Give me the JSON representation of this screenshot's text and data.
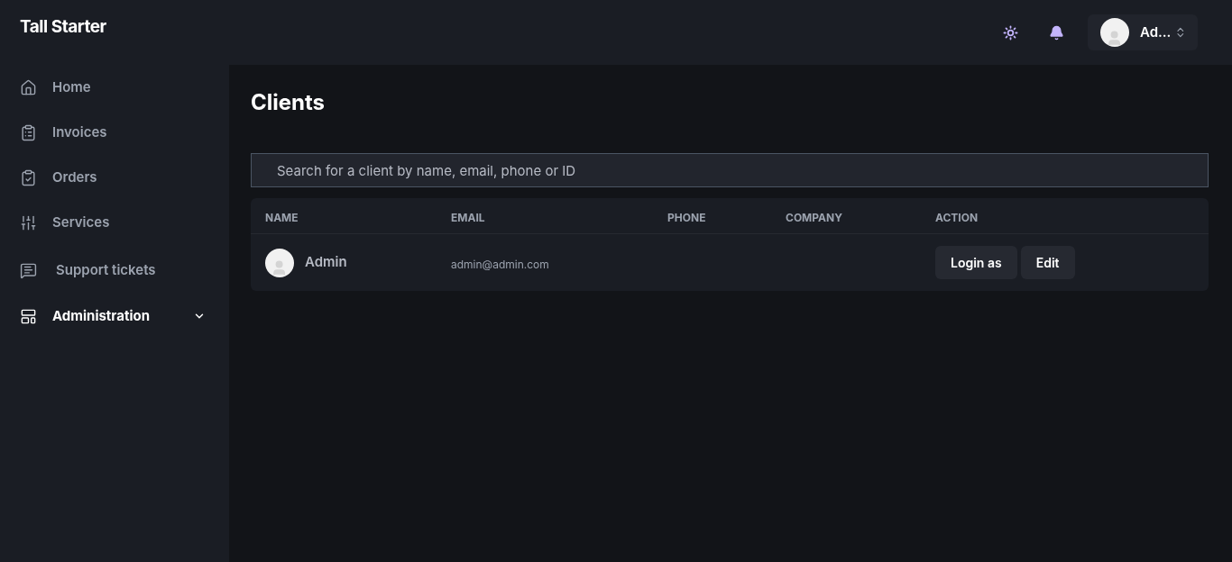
{
  "app": {
    "title": "Tall Starter"
  },
  "sidebar": {
    "items": [
      {
        "label": "Home",
        "selected": false,
        "kind": "link"
      },
      {
        "label": "Invoices",
        "selected": false,
        "kind": "link"
      },
      {
        "label": "Orders",
        "selected": false,
        "kind": "link"
      },
      {
        "label": "Services",
        "selected": false,
        "kind": "link"
      },
      {
        "label": "Support tickets",
        "selected": false,
        "kind": "link"
      },
      {
        "label": "Administration",
        "selected": true,
        "kind": "group"
      }
    ]
  },
  "header": {
    "user": {
      "name": "Ad..."
    }
  },
  "page": {
    "title": "Clients",
    "search": {
      "placeholder": "Search for a client by name, email, phone or ID"
    }
  },
  "table": {
    "columns": [
      "NAME",
      "EMAIL",
      "PHONE",
      "COMPANY",
      "ACTION"
    ],
    "rows": [
      {
        "name": "Admin",
        "email": "admin@admin.com",
        "actions": [
          "Login as",
          "Edit"
        ]
      }
    ]
  }
}
